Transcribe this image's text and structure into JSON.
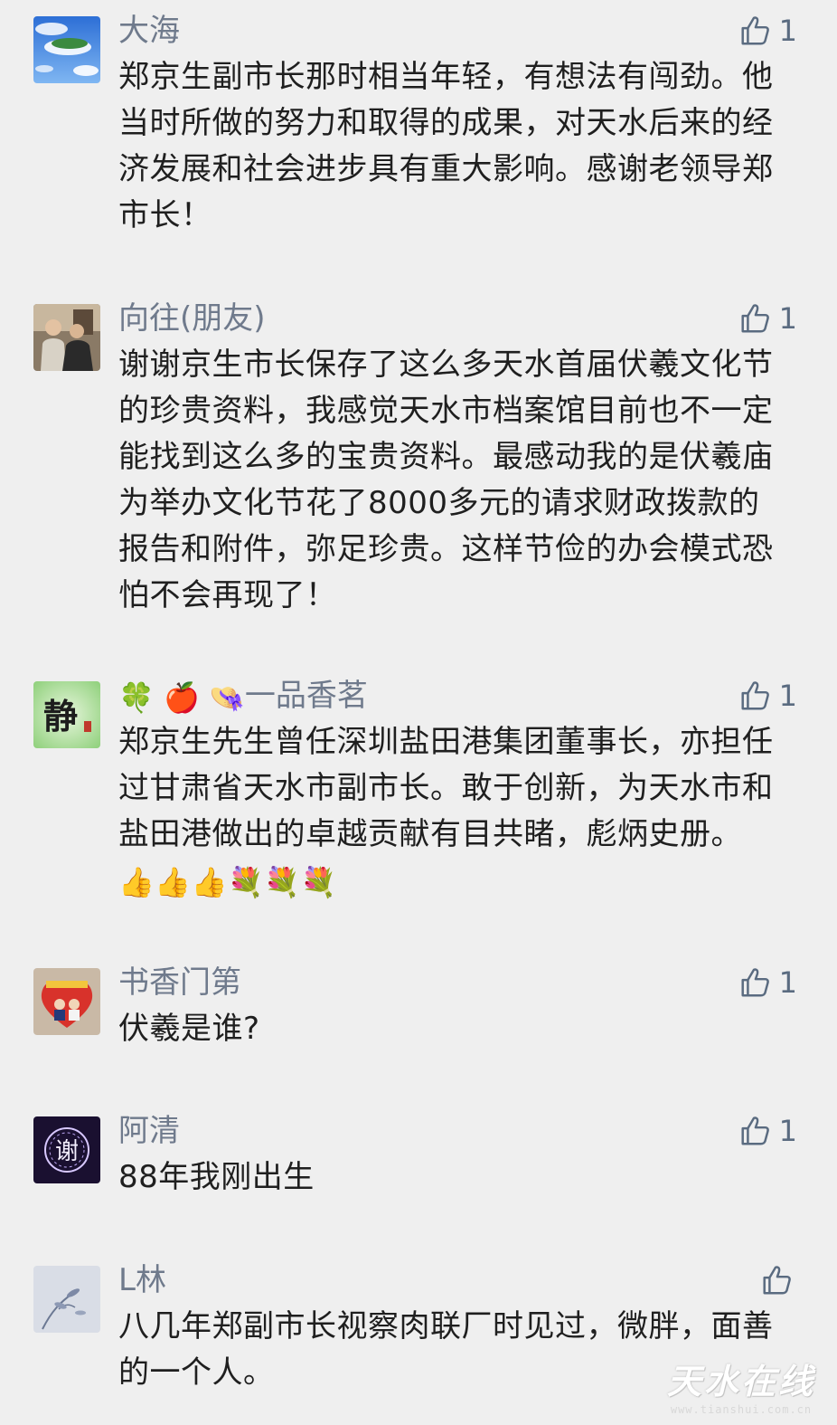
{
  "comments": [
    {
      "nickname": "大海",
      "likes": "1",
      "text": "郑京生副市长那时相当年轻，有想法有闯劲。他当时所做的努力和取得的成果，对天水后来的经济发展和社会进步具有重大影响。感谢老领导郑市长！"
    },
    {
      "nickname": "向往(朋友)",
      "likes": "1",
      "text": "谢谢京生市长保存了这么多天水首届伏羲文化节的珍贵资料，我感觉天水市档案馆目前也不一定能找到这么多的宝贵资料。最感动我的是伏羲庙为举办文化节花了8000多元的请求财政拨款的报告和附件，弥足珍贵。这样节俭的办会模式恐怕不会再现了！"
    },
    {
      "nickname_emoji": "🍀 🍎 👒",
      "nickname": "一品香茗",
      "likes": "1",
      "text": "郑京生先生曾任深圳盐田港集团董事长，亦担任过甘肃省天水市副市长。敢于创新，为天水市和盐田港做出的卓越贡献有目共睹，彪炳史册。",
      "text_emoji": "👍👍👍💐💐💐",
      "avatar_text": "静"
    },
    {
      "nickname": "书香门第",
      "likes": "1",
      "text": "伏羲是谁?"
    },
    {
      "nickname": "阿清",
      "likes": "1",
      "text": "88年我刚出生",
      "avatar_text": "谢"
    },
    {
      "nickname": "L林",
      "likes": "",
      "text": "八几年郑副市长视察肉联厂时见过，微胖，面善的一个人。"
    }
  ],
  "watermark": {
    "main": "天水在线",
    "url": "www.tianshui.com.cn"
  },
  "colors": {
    "background": "#efefef",
    "nickname": "#6f7a8c",
    "body_text": "#1f1f1f",
    "like_icon": "#5a6b80"
  },
  "icons": {
    "like": "thumbs-up-outline-icon"
  }
}
